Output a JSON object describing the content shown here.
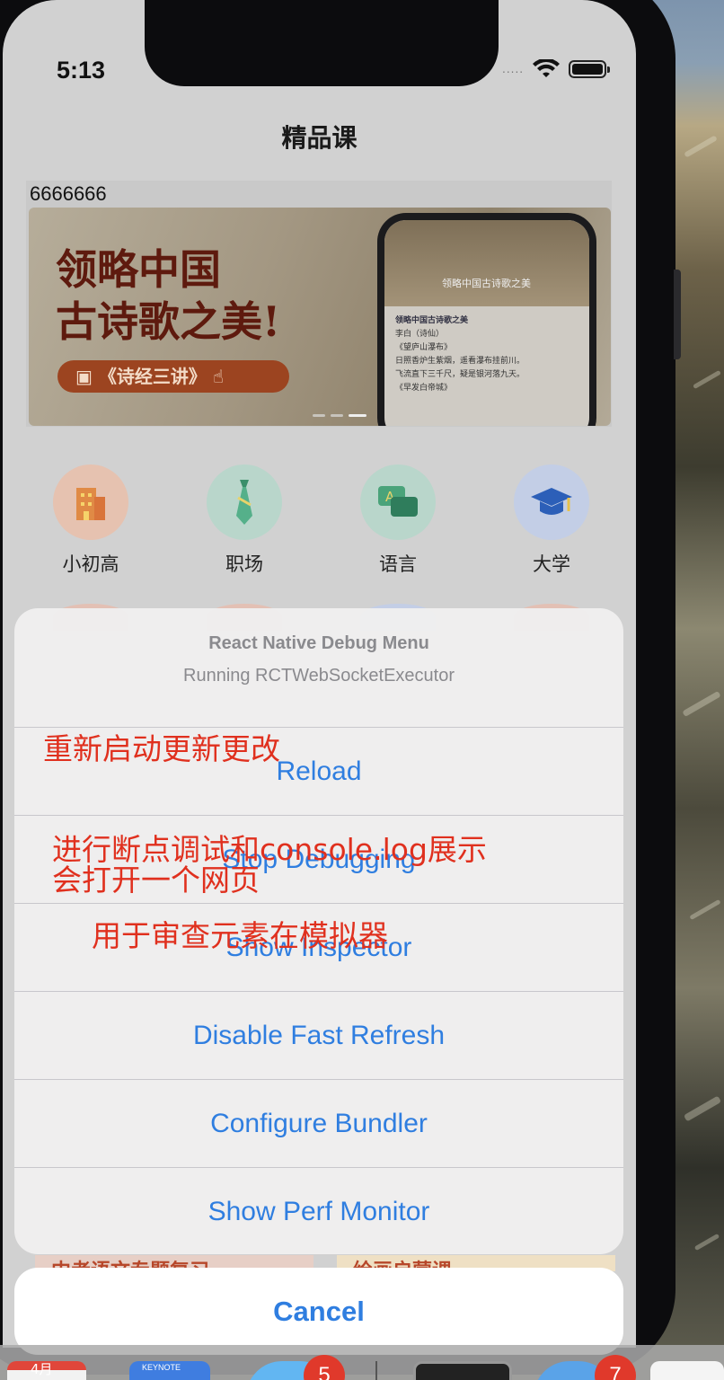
{
  "status_bar": {
    "time": "5:13",
    "signal": "....."
  },
  "nav": {
    "title": "精品课"
  },
  "banner": {
    "caption": "6666666",
    "headline_line1": "领略中国",
    "headline_line2": "古诗歌之美!",
    "pill_text": "《诗经三讲》",
    "phone_title": "领略中国古诗歌之美",
    "phone_author_title": "领略中国古诗歌之美",
    "phone_author": "李白（诗仙）",
    "phone_poem_title": "《望庐山瀑布》",
    "phone_poem_line1": "日照香炉生紫烟，遥看瀑布挂前川。",
    "phone_poem_line2": "飞流直下三千尺，疑是银河落九天。",
    "phone_poem2_title": "《早发白帝城》"
  },
  "categories": [
    {
      "label": "小初高",
      "icon": "building-icon",
      "color": "#e9b496"
    },
    {
      "label": "职场",
      "icon": "tie-icon",
      "color": "#a9cfc0"
    },
    {
      "label": "语言",
      "icon": "chat-icon",
      "color": "#a9cfc0"
    },
    {
      "label": "大学",
      "icon": "graduation-cap-icon",
      "color": "#b9c8e8"
    }
  ],
  "debug_menu": {
    "title": "React Native Debug Menu",
    "subtitle": "Running RCTWebSocketExecutor",
    "items": [
      {
        "label": "Reload"
      },
      {
        "label": "Stop Debugging"
      },
      {
        "label": "Show Inspector"
      },
      {
        "label": "Disable Fast Refresh"
      },
      {
        "label": "Configure Bundler"
      },
      {
        "label": "Show Perf Monitor"
      }
    ],
    "cancel": "Cancel"
  },
  "peek_cards": {
    "left": "中考语文专题复习",
    "right": "绘画启蒙课"
  },
  "annotations": {
    "reload": "重新启动更新更改",
    "debug_line1": "进行断点调试和console.log展示",
    "debug_line2": "会打开一个网页",
    "inspector": "用于审查元素在模拟器"
  },
  "dock": {
    "calendar_month": "4月",
    "keynote_label": "KEYNOTE",
    "badge_1": "5",
    "badge_2": "7"
  },
  "colors": {
    "action_blue": "#2f7ee0",
    "annotation_red": "#e0301e",
    "badge_red": "#e0392b"
  }
}
